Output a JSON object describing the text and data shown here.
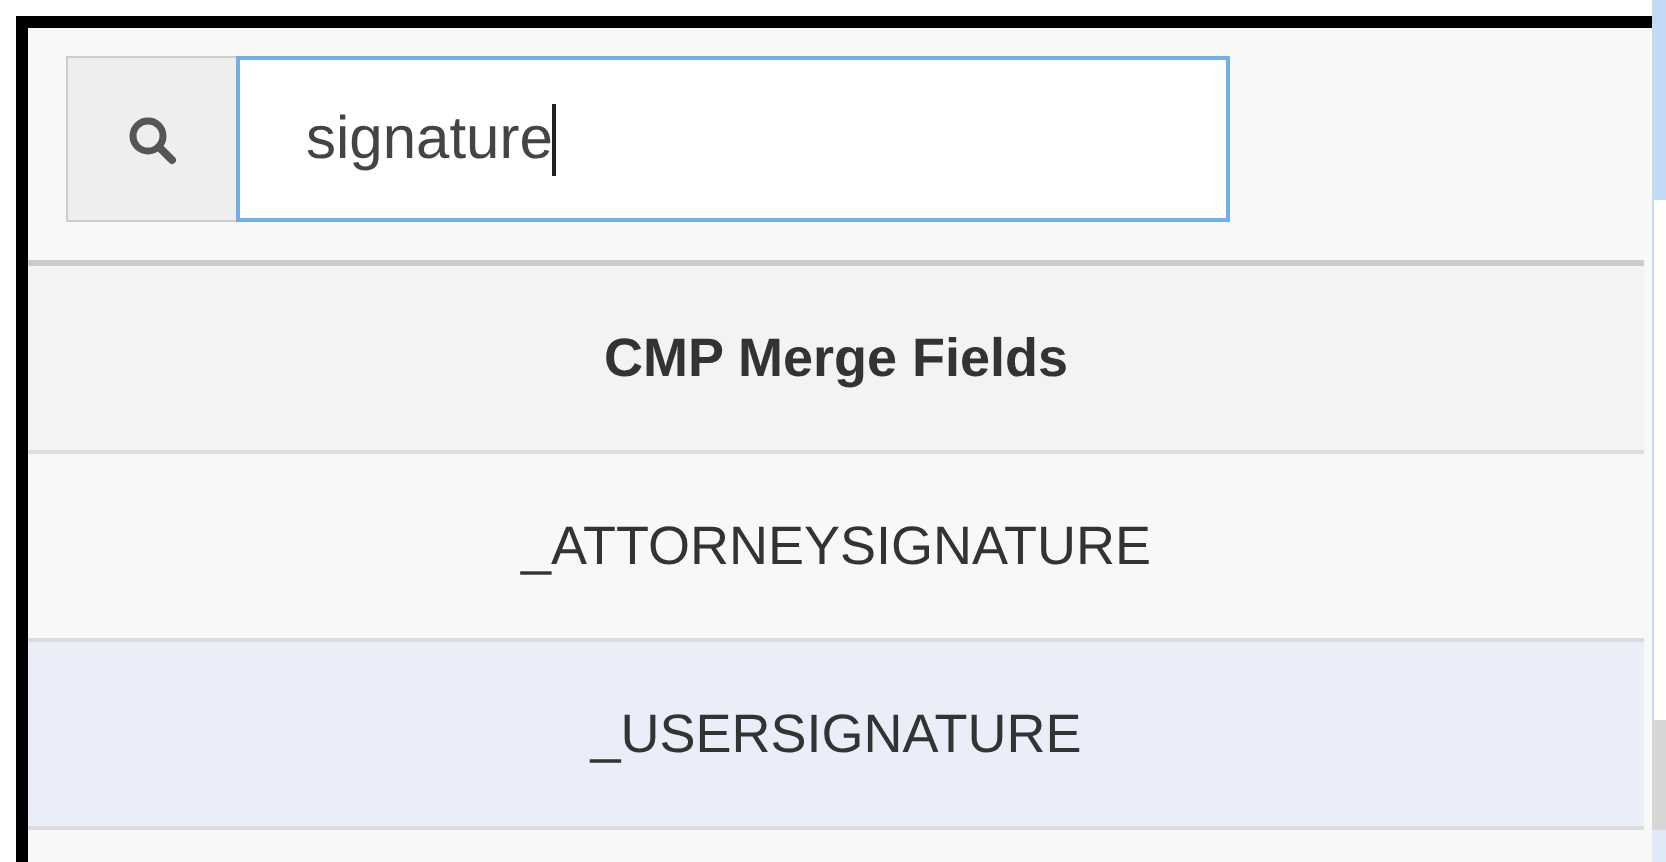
{
  "search": {
    "value": "signature"
  },
  "table": {
    "columns": [
      "CMP Merge Fields"
    ],
    "rows": [
      {
        "cell": "_ATTORNEYSIGNATURE",
        "selected": false
      },
      {
        "cell": "_USERSIGNATURE",
        "selected": true
      }
    ]
  }
}
